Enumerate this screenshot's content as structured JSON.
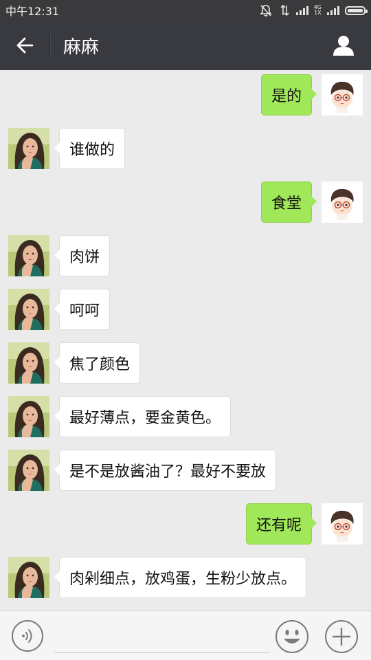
{
  "status_bar": {
    "time": "中午12:31",
    "network_type_top": "4G",
    "network_type_bottom": "1X",
    "icons": [
      "mute-icon",
      "vibrate-icon",
      "signal-icon",
      "network-type-icon",
      "signal-icon",
      "battery-icon"
    ]
  },
  "header": {
    "title": "麻麻",
    "back_icon": "back-arrow-icon",
    "profile_icon": "person-icon"
  },
  "messages": [
    {
      "side": "right",
      "text": "是的"
    },
    {
      "side": "left",
      "text": "谁做的"
    },
    {
      "side": "right",
      "text": "食堂"
    },
    {
      "side": "left",
      "text": "肉饼"
    },
    {
      "side": "left",
      "text": "呵呵"
    },
    {
      "side": "left",
      "text": "焦了颜色"
    },
    {
      "side": "left",
      "text": "最好薄点，要金黄色。"
    },
    {
      "side": "left",
      "text": "是不是放酱油了？最好不要放"
    },
    {
      "side": "right",
      "text": "还有呢"
    },
    {
      "side": "left",
      "text": "肉剁细点，放鸡蛋，生粉少放点。"
    }
  ],
  "input_bar": {
    "value": "",
    "placeholder": "",
    "voice_icon": "voice-icon",
    "emoji_icon": "emoji-icon",
    "plus_icon": "plus-icon"
  },
  "colors": {
    "header_bg": "#393a3f",
    "chat_bg": "#ebebeb",
    "sent_bubble": "#a0e75a",
    "received_bubble": "#ffffff"
  }
}
